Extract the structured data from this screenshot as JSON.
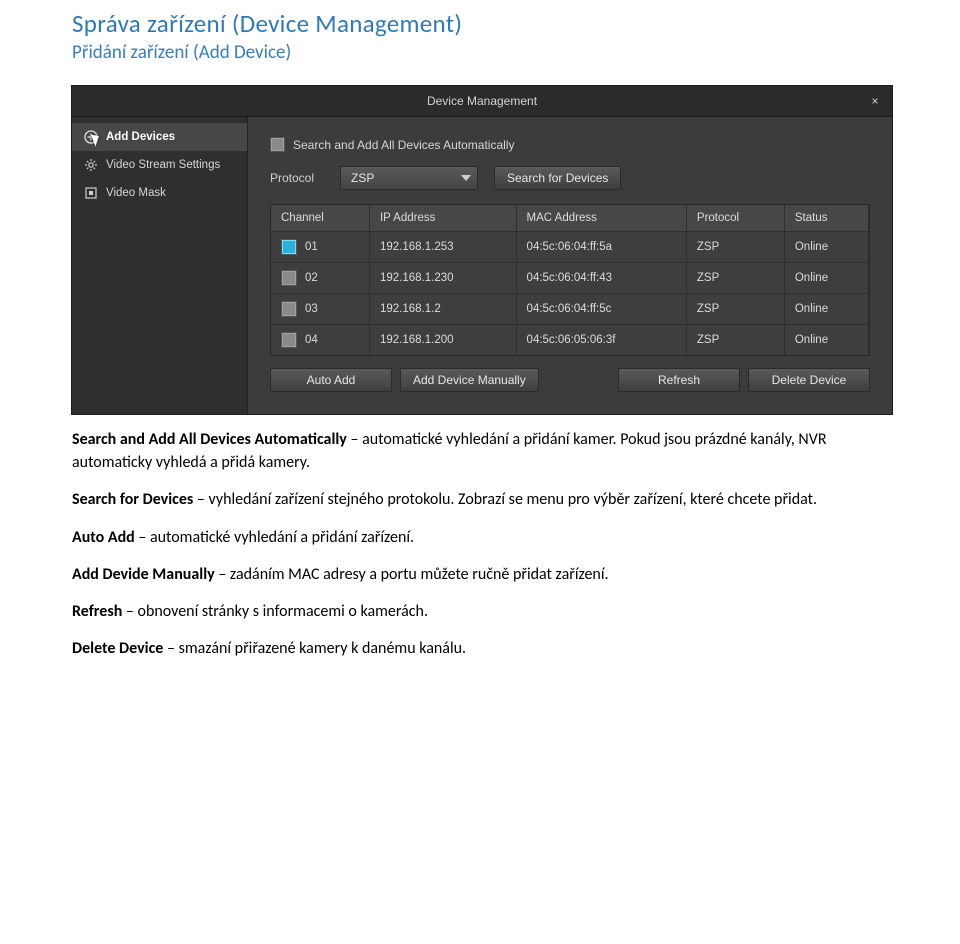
{
  "headings": {
    "h1": "Správa zařízení (Device Management)",
    "h2": "Přidání zařízení (Add Device)"
  },
  "screenshot": {
    "title": "Device Management",
    "close": "×",
    "sidebar": {
      "items": [
        {
          "label": "Add Devices",
          "icon": "plus-circle"
        },
        {
          "label": "Video Stream Settings",
          "icon": "gear"
        },
        {
          "label": "Video Mask",
          "icon": "square"
        }
      ]
    },
    "main": {
      "auto_search_label": "Search and Add All Devices Automatically",
      "protocol_label": "Protocol",
      "protocol_value": "ZSP",
      "search_button": "Search for Devices",
      "columns": {
        "channel": "Channel",
        "ip": "IP Address",
        "mac": "MAC Address",
        "protocol": "Protocol",
        "status": "Status"
      },
      "rows": [
        {
          "selected": true,
          "channel": "01",
          "ip": "192.168.1.253",
          "mac": "04:5c:06:04:ff:5a",
          "protocol": "ZSP",
          "status": "Online"
        },
        {
          "selected": false,
          "channel": "02",
          "ip": "192.168.1.230",
          "mac": "04:5c:06:04:ff:43",
          "protocol": "ZSP",
          "status": "Online"
        },
        {
          "selected": false,
          "channel": "03",
          "ip": "192.168.1.2",
          "mac": "04:5c:06:04:ff:5c",
          "protocol": "ZSP",
          "status": "Online"
        },
        {
          "selected": false,
          "channel": "04",
          "ip": "192.168.1.200",
          "mac": "04:5c:06:05:06:3f",
          "protocol": "ZSP",
          "status": "Online"
        }
      ],
      "buttons": {
        "auto_add": "Auto Add",
        "add_manual": "Add Device Manually",
        "refresh": "Refresh",
        "delete": "Delete Device"
      }
    }
  },
  "paragraphs": {
    "p1_term": "Search and Add All Devices Automatically",
    "p1_rest": " – automatické vyhledání a přidání kamer. Pokud jsou prázdné kanály, NVR automaticky vyhledá a přidá kamery.",
    "p2_term": "Search for Devices",
    "p2_rest": " – vyhledání zařízení stejného protokolu. Zobrazí se menu pro výběr zařízení, které chcete přidat.",
    "p3_term": "Auto Add",
    "p3_rest": " – automatické vyhledání a přidání zařízení.",
    "p4_term": "Add Devide Manually",
    "p4_rest": " – zadáním MAC adresy a portu můžete ručně přidat zařízení.",
    "p5_term": "Refresh",
    "p5_rest": " – obnovení stránky s informacemi o kamerách.",
    "p6_term": "Delete Device",
    "p6_rest": " – smazání přiřazené kamery k danému kanálu."
  }
}
